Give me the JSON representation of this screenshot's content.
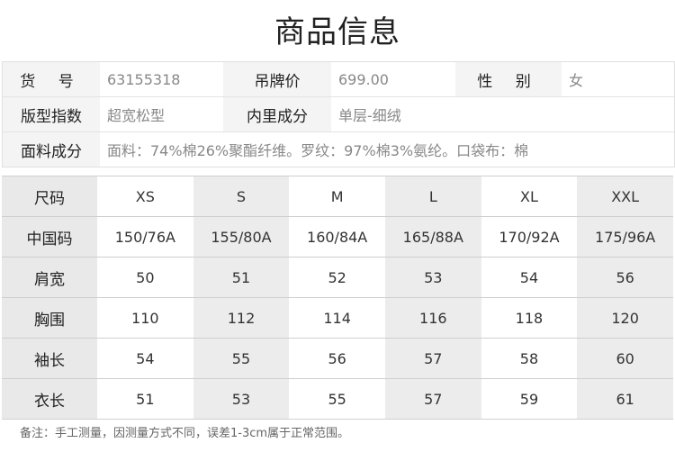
{
  "title": "商品信息",
  "info": {
    "row1": {
      "item_no_label": "货 号",
      "item_no": "63155318",
      "tag_price_label": "吊牌价",
      "tag_price": "699.00",
      "gender_label": "性 别",
      "gender": "女"
    },
    "row2": {
      "fit_label": "版型指数",
      "fit": "超宽松型",
      "lining_label": "内里成分",
      "lining": "单层-细绒"
    },
    "row3": {
      "fabric_label": "面料成分",
      "fabric": "面料：74%棉26%聚酯纤维。罗纹：97%棉3%氨纶。口袋布：棉"
    }
  },
  "size_table": {
    "header_label": "尺码",
    "sizes": [
      "XS",
      "S",
      "M",
      "L",
      "XL",
      "XXL"
    ],
    "rows": [
      {
        "label": "中国码",
        "values": [
          "150/76A",
          "155/80A",
          "160/84A",
          "165/88A",
          "170/92A",
          "175/96A"
        ]
      },
      {
        "label": "肩宽",
        "values": [
          "50",
          "51",
          "52",
          "53",
          "54",
          "56"
        ]
      },
      {
        "label": "胸围",
        "values": [
          "110",
          "112",
          "114",
          "116",
          "118",
          "120"
        ]
      },
      {
        "label": "袖长",
        "values": [
          "54",
          "55",
          "56",
          "57",
          "58",
          "60"
        ]
      },
      {
        "label": "衣长",
        "values": [
          "51",
          "53",
          "55",
          "57",
          "59",
          "61"
        ]
      }
    ]
  },
  "note": "备注：手工测量，因测量方式不同，误差1-3cm属于正常范围。"
}
